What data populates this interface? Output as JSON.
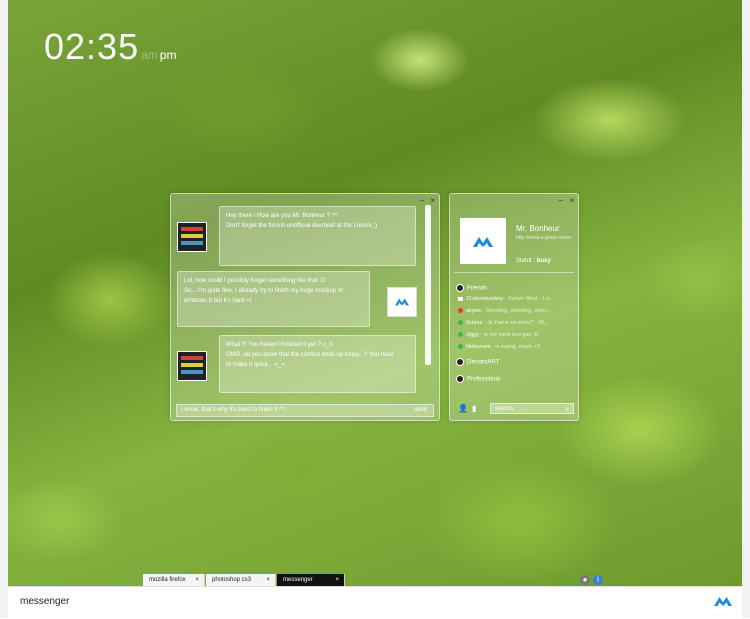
{
  "clock": {
    "time": "02:35",
    "am": "am",
    "pm": "pm"
  },
  "chat": {
    "controls": {
      "minimize": "‒",
      "close": "×"
    },
    "messages": [
      {
        "from": "other",
        "lines": [
          "Hey there ! How are you Mr. Bonheur ? ^^",
          "Don't forget the french unofficial devmeet at the Louvre ;)"
        ]
      },
      {
        "from": "self",
        "lines": [
          "Lol, how could I possibly forget something like that :D",
          "So... I'm quite fine, I already try to finish my huge mockup of",
          "windows 8 but it's hard =("
        ]
      },
      {
        "from": "other",
        "lines": [
          "What ?! You haven't finished it yet ? o_o",
          "OMG, do you know that the contest ends up today...? You have",
          "to make it quick... =_="
        ]
      }
    ],
    "input_value": "I know, that's why it's hard to finish it ^^;",
    "send_label": "send"
  },
  "contacts": {
    "controls": {
      "minimize": "‒",
      "close": "×"
    },
    "profile": {
      "name": "Mr. Bonheur",
      "url": "http://www.a-great-movie",
      "status_label": "Statut :",
      "status_value": "busy"
    },
    "groups": [
      {
        "name": "Friends"
      },
      {
        "name": "DeviantART"
      },
      {
        "name": "Professional"
      }
    ],
    "friends": [
      {
        "name": "21stcenturyboy",
        "message": " - Kanye West - Lo...",
        "color": "#ffffff"
      },
      {
        "name": "akyan",
        "message": " - Shooting, shooting, shoo...",
        "color": "#e03a2a"
      },
      {
        "name": "0ctans",
        "message": " - Je t'aime en enfer!\" - M...",
        "color": "#3fb54a"
      },
      {
        "name": "Jiggy",
        "message": " - je me sens tout gay :D",
        "color": "#3fb54a"
      },
      {
        "name": "Nekozumi",
        "message": " - is eating, miam <3",
        "color": "#3fb54a"
      }
    ],
    "search_placeholder": "search"
  },
  "taskbar": [
    {
      "label": "mozilla firefox",
      "active": false
    },
    {
      "label": "photoshop cs3",
      "active": false
    },
    {
      "label": "messenger",
      "active": true
    }
  ],
  "bottom": {
    "title": "messenger"
  },
  "colors": {
    "brand": "#1a8fd6"
  }
}
